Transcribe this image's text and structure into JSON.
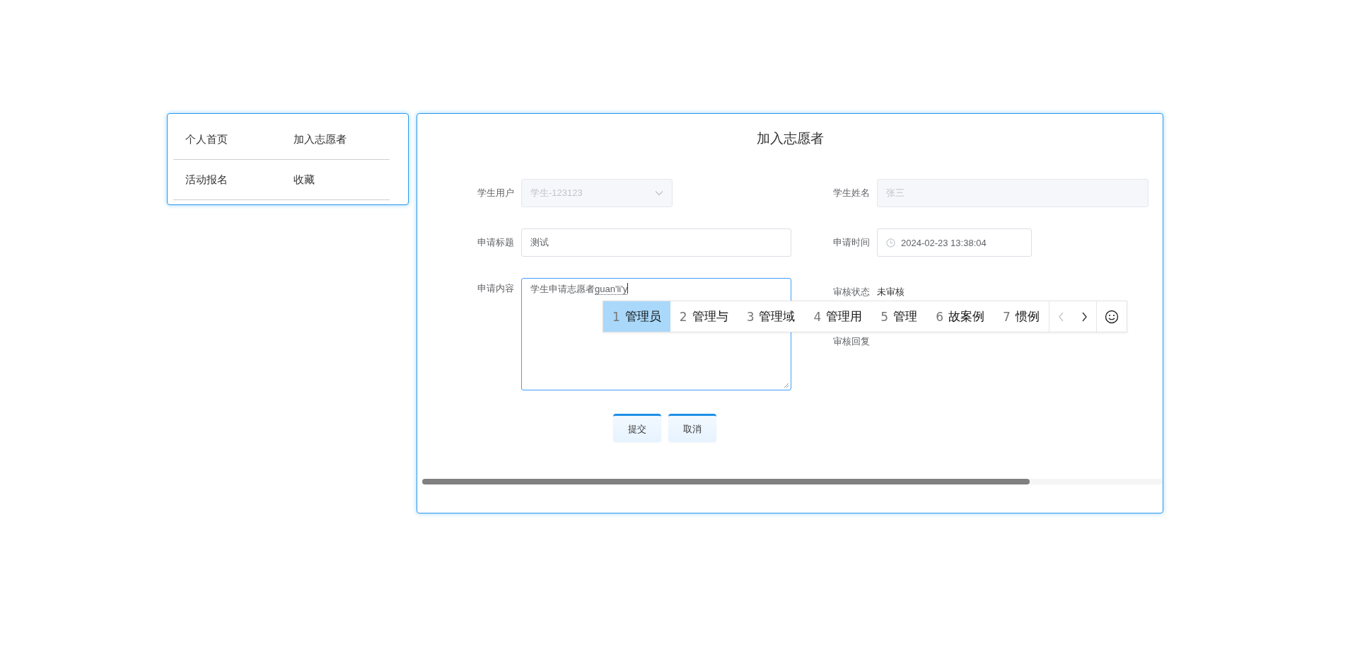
{
  "sidebar": {
    "items": [
      {
        "label": "个人首页"
      },
      {
        "label": "加入志愿者"
      },
      {
        "label": "活动报名"
      },
      {
        "label": "收藏"
      }
    ]
  },
  "form": {
    "title": "加入志愿者",
    "fields": [
      {
        "kind": "select",
        "label": "学生用户",
        "value": "学生-123123",
        "disabled": true
      },
      {
        "kind": "text",
        "label": "学生姓名",
        "value": "张三",
        "disabled": true
      },
      {
        "kind": "text",
        "label": "申请标题",
        "value": "测试",
        "disabled": false
      },
      {
        "kind": "datetime",
        "label": "申请时间",
        "value": "2024-02-23 13:38:04",
        "disabled": false
      },
      {
        "kind": "textarea",
        "label": "申请内容",
        "value": "学生申请志愿者",
        "composition": "guan'li'y",
        "focused": true
      },
      {
        "kind": "static",
        "label": "审核状态",
        "value": "未审核"
      },
      {
        "kind": "static",
        "label": "审核回复"
      }
    ],
    "buttons": [
      {
        "label": "提交"
      },
      {
        "label": "取消"
      }
    ]
  },
  "ime": {
    "prev_disabled": true,
    "candidates": [
      {
        "index": "1",
        "text": "管理员",
        "selected": true
      },
      {
        "index": "2",
        "text": "管理与",
        "selected": false
      },
      {
        "index": "3",
        "text": "管理域",
        "selected": false
      },
      {
        "index": "4",
        "text": "管理用",
        "selected": false
      },
      {
        "index": "5",
        "text": "管理",
        "selected": false
      },
      {
        "index": "6",
        "text": "故案例",
        "selected": false
      },
      {
        "index": "7",
        "text": "惯例",
        "selected": false
      }
    ]
  }
}
